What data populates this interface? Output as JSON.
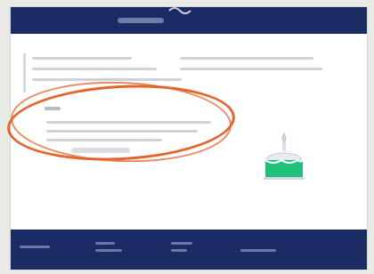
{
  "colors": {
    "header_bg": "#1a2c63",
    "footer_bg": "#1a2c63",
    "accent_green": "#20c07a",
    "annotation": "#e16630"
  },
  "header": {
    "title": ""
  },
  "checkbox": {
    "checked": true
  }
}
